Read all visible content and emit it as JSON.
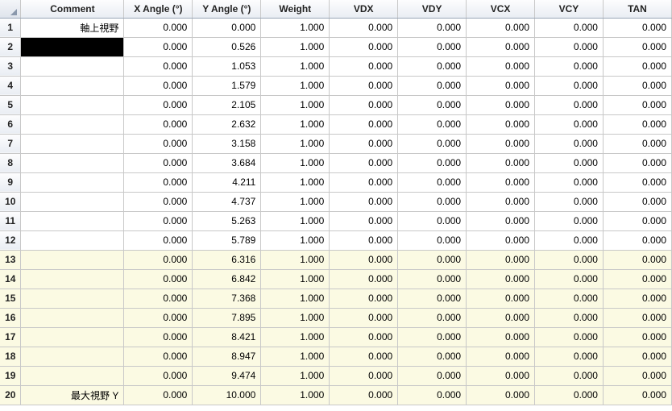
{
  "columns": [
    "Comment",
    "X Angle (°)",
    "Y Angle (°)",
    "Weight",
    "VDX",
    "VDY",
    "VCX",
    "VCY",
    "TAN"
  ],
  "rows": [
    {
      "n": "1",
      "comment": "軸上視野",
      "xang": "0.000",
      "yang": "0.000",
      "weight": "1.000",
      "vdx": "0.000",
      "vdy": "0.000",
      "vcx": "0.000",
      "vcy": "0.000",
      "tan": "0.000",
      "shade": false,
      "black": false
    },
    {
      "n": "2",
      "comment": "",
      "xang": "0.000",
      "yang": "0.526",
      "weight": "1.000",
      "vdx": "0.000",
      "vdy": "0.000",
      "vcx": "0.000",
      "vcy": "0.000",
      "tan": "0.000",
      "shade": false,
      "black": true
    },
    {
      "n": "3",
      "comment": "",
      "xang": "0.000",
      "yang": "1.053",
      "weight": "1.000",
      "vdx": "0.000",
      "vdy": "0.000",
      "vcx": "0.000",
      "vcy": "0.000",
      "tan": "0.000",
      "shade": false,
      "black": false
    },
    {
      "n": "4",
      "comment": "",
      "xang": "0.000",
      "yang": "1.579",
      "weight": "1.000",
      "vdx": "0.000",
      "vdy": "0.000",
      "vcx": "0.000",
      "vcy": "0.000",
      "tan": "0.000",
      "shade": false,
      "black": false
    },
    {
      "n": "5",
      "comment": "",
      "xang": "0.000",
      "yang": "2.105",
      "weight": "1.000",
      "vdx": "0.000",
      "vdy": "0.000",
      "vcx": "0.000",
      "vcy": "0.000",
      "tan": "0.000",
      "shade": false,
      "black": false
    },
    {
      "n": "6",
      "comment": "",
      "xang": "0.000",
      "yang": "2.632",
      "weight": "1.000",
      "vdx": "0.000",
      "vdy": "0.000",
      "vcx": "0.000",
      "vcy": "0.000",
      "tan": "0.000",
      "shade": false,
      "black": false
    },
    {
      "n": "7",
      "comment": "",
      "xang": "0.000",
      "yang": "3.158",
      "weight": "1.000",
      "vdx": "0.000",
      "vdy": "0.000",
      "vcx": "0.000",
      "vcy": "0.000",
      "tan": "0.000",
      "shade": false,
      "black": false
    },
    {
      "n": "8",
      "comment": "",
      "xang": "0.000",
      "yang": "3.684",
      "weight": "1.000",
      "vdx": "0.000",
      "vdy": "0.000",
      "vcx": "0.000",
      "vcy": "0.000",
      "tan": "0.000",
      "shade": false,
      "black": false
    },
    {
      "n": "9",
      "comment": "",
      "xang": "0.000",
      "yang": "4.211",
      "weight": "1.000",
      "vdx": "0.000",
      "vdy": "0.000",
      "vcx": "0.000",
      "vcy": "0.000",
      "tan": "0.000",
      "shade": false,
      "black": false
    },
    {
      "n": "10",
      "comment": "",
      "xang": "0.000",
      "yang": "4.737",
      "weight": "1.000",
      "vdx": "0.000",
      "vdy": "0.000",
      "vcx": "0.000",
      "vcy": "0.000",
      "tan": "0.000",
      "shade": false,
      "black": false
    },
    {
      "n": "11",
      "comment": "",
      "xang": "0.000",
      "yang": "5.263",
      "weight": "1.000",
      "vdx": "0.000",
      "vdy": "0.000",
      "vcx": "0.000",
      "vcy": "0.000",
      "tan": "0.000",
      "shade": false,
      "black": false
    },
    {
      "n": "12",
      "comment": "",
      "xang": "0.000",
      "yang": "5.789",
      "weight": "1.000",
      "vdx": "0.000",
      "vdy": "0.000",
      "vcx": "0.000",
      "vcy": "0.000",
      "tan": "0.000",
      "shade": false,
      "black": false
    },
    {
      "n": "13",
      "comment": "",
      "xang": "0.000",
      "yang": "6.316",
      "weight": "1.000",
      "vdx": "0.000",
      "vdy": "0.000",
      "vcx": "0.000",
      "vcy": "0.000",
      "tan": "0.000",
      "shade": true,
      "black": false
    },
    {
      "n": "14",
      "comment": "",
      "xang": "0.000",
      "yang": "6.842",
      "weight": "1.000",
      "vdx": "0.000",
      "vdy": "0.000",
      "vcx": "0.000",
      "vcy": "0.000",
      "tan": "0.000",
      "shade": true,
      "black": false
    },
    {
      "n": "15",
      "comment": "",
      "xang": "0.000",
      "yang": "7.368",
      "weight": "1.000",
      "vdx": "0.000",
      "vdy": "0.000",
      "vcx": "0.000",
      "vcy": "0.000",
      "tan": "0.000",
      "shade": true,
      "black": false
    },
    {
      "n": "16",
      "comment": "",
      "xang": "0.000",
      "yang": "7.895",
      "weight": "1.000",
      "vdx": "0.000",
      "vdy": "0.000",
      "vcx": "0.000",
      "vcy": "0.000",
      "tan": "0.000",
      "shade": true,
      "black": false
    },
    {
      "n": "17",
      "comment": "",
      "xang": "0.000",
      "yang": "8.421",
      "weight": "1.000",
      "vdx": "0.000",
      "vdy": "0.000",
      "vcx": "0.000",
      "vcy": "0.000",
      "tan": "0.000",
      "shade": true,
      "black": false
    },
    {
      "n": "18",
      "comment": "",
      "xang": "0.000",
      "yang": "8.947",
      "weight": "1.000",
      "vdx": "0.000",
      "vdy": "0.000",
      "vcx": "0.000",
      "vcy": "0.000",
      "tan": "0.000",
      "shade": true,
      "black": false
    },
    {
      "n": "19",
      "comment": "",
      "xang": "0.000",
      "yang": "9.474",
      "weight": "1.000",
      "vdx": "0.000",
      "vdy": "0.000",
      "vcx": "0.000",
      "vcy": "0.000",
      "tan": "0.000",
      "shade": true,
      "black": false
    },
    {
      "n": "20",
      "comment": "最大視野 Y",
      "xang": "0.000",
      "yang": "10.000",
      "weight": "1.000",
      "vdx": "0.000",
      "vdy": "0.000",
      "vcx": "0.000",
      "vcy": "0.000",
      "tan": "0.000",
      "shade": true,
      "black": false
    }
  ]
}
